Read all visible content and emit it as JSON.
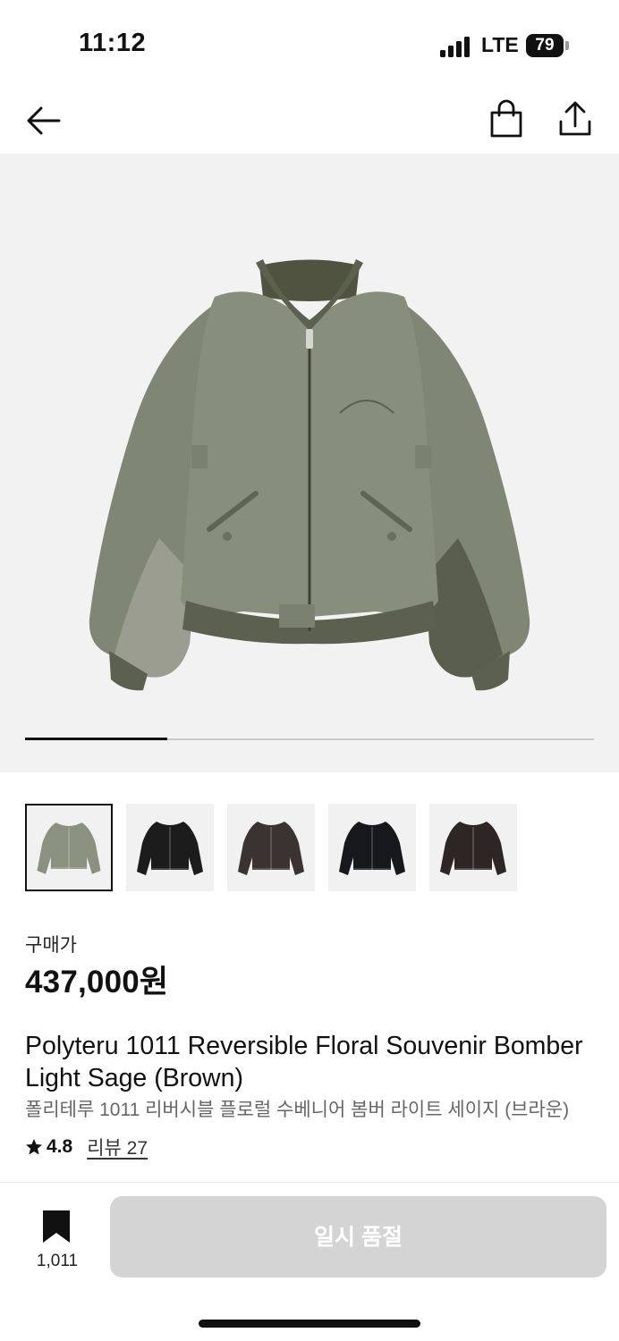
{
  "status_bar": {
    "time": "11:12",
    "network": "LTE",
    "battery": "79"
  },
  "nav": {
    "back_icon": "arrow-left-icon",
    "cart_icon": "shopping-bag-icon",
    "share_icon": "share-upload-icon"
  },
  "gallery": {
    "progress": 0.25,
    "thumbnails": [
      {
        "color": "#8a917e",
        "active": true
      },
      {
        "color": "#1c1c1c",
        "active": false
      },
      {
        "color": "#3a332f",
        "active": false
      },
      {
        "color": "#16181c",
        "active": false
      },
      {
        "color": "#2e2624",
        "active": false
      }
    ]
  },
  "product": {
    "price_label": "구매가",
    "price": "437,000원",
    "title_en": "Polyteru 1011 Reversible Floral Souvenir Bomber Light Sage (Brown)",
    "title_ko": "폴리테루 1011 리버시블 플로럴 수베니어 봄버 라이트 세이지 (브라운)",
    "rating": "4.8",
    "review_link": "리뷰 27"
  },
  "bottom_bar": {
    "bookmark_count": "1,011",
    "soldout_label": "일시 품절"
  },
  "colors": {
    "jacket_main": "#878e7b",
    "jacket_dark": "#5b604f",
    "hero_bg": "#f2f2f2",
    "button_disabled": "#d4d4d4"
  }
}
